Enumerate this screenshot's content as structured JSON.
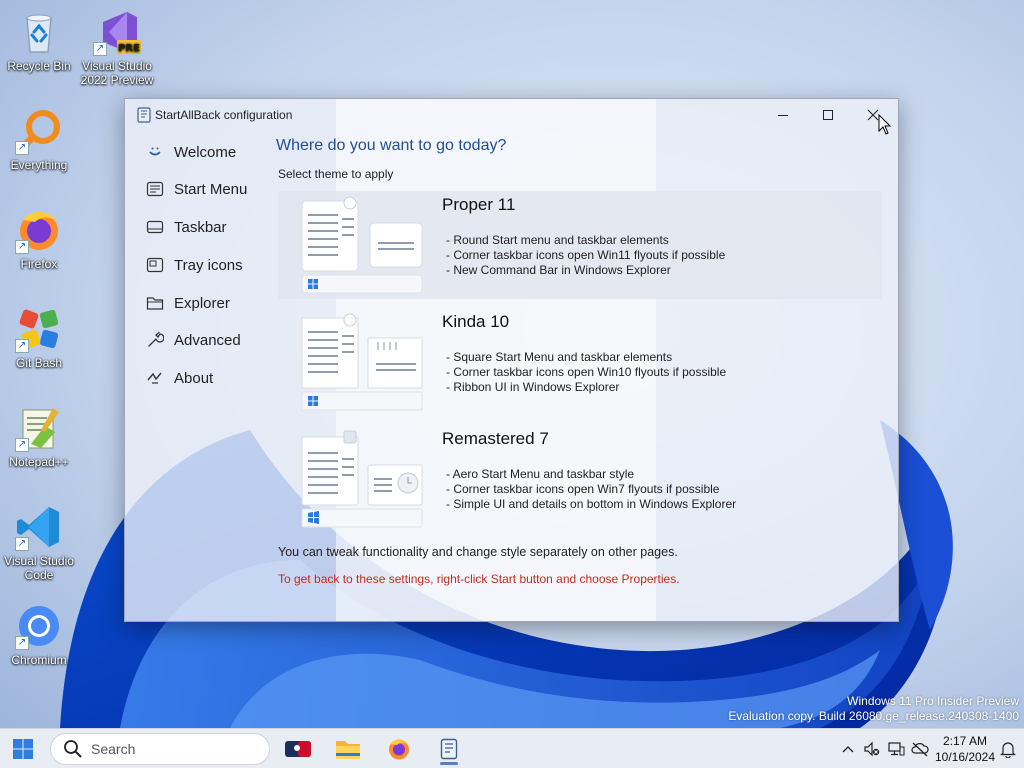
{
  "desktop": {
    "icons": [
      {
        "label": "Recycle Bin",
        "icon": "recycle-bin-icon"
      },
      {
        "label": "Visual Studio 2022 Preview",
        "icon": "visual-studio-icon",
        "badge": "PRE"
      },
      {
        "label": "Everything",
        "icon": "everything-search-icon"
      },
      {
        "label": "Firefox",
        "icon": "firefox-icon"
      },
      {
        "label": "Git Bash",
        "icon": "git-bash-icon"
      },
      {
        "label": "Notepad++",
        "icon": "notepad-plus-plus-icon"
      },
      {
        "label": "Visual Studio Code",
        "icon": "vscode-icon"
      },
      {
        "label": "Chromium",
        "icon": "chromium-icon"
      }
    ],
    "watermark": {
      "line1": "Windows 11 Pro Insider Preview",
      "line2": "Evaluation copy. Build 26080.ge_release.240308-1400"
    }
  },
  "window": {
    "title": "StartAllBack configuration",
    "nav": [
      {
        "label": "Welcome",
        "icon": "smile-icon"
      },
      {
        "label": "Start Menu",
        "icon": "start-menu-icon"
      },
      {
        "label": "Taskbar",
        "icon": "taskbar-icon"
      },
      {
        "label": "Tray icons",
        "icon": "tray-icon"
      },
      {
        "label": "Explorer",
        "icon": "folder-icon"
      },
      {
        "label": "Advanced",
        "icon": "wrench-icon"
      },
      {
        "label": "About",
        "icon": "about-icon"
      }
    ],
    "heading": "Where do you want to go today?",
    "subheading": "Select theme to apply",
    "themes": [
      {
        "name": "Proper 11",
        "features": [
          "- Round Start menu and taskbar elements",
          "- Corner taskbar icons open Win11 flyouts if possible",
          "- New Command Bar in Windows Explorer"
        ]
      },
      {
        "name": "Kinda 10",
        "features": [
          "- Square Start Menu and taskbar elements",
          "- Corner taskbar icons open Win10 flyouts if possible",
          "- Ribbon UI in Windows Explorer"
        ]
      },
      {
        "name": "Remastered 7",
        "features": [
          "- Aero Start Menu and taskbar style",
          "- Corner taskbar icons open Win7 flyouts if possible",
          "- Simple UI and details on bottom in Windows Explorer"
        ]
      }
    ],
    "note": "You can tweak functionality and change style separately on other pages.",
    "hint": "To get back to these settings, right-click Start button and choose Properties."
  },
  "taskbar": {
    "search_placeholder": "Search",
    "apps": [
      "mlb-app-icon",
      "file-explorer-icon",
      "firefox-icon",
      "startallback-icon"
    ],
    "clock": {
      "time": "2:17 AM",
      "date": "10/16/2024"
    }
  },
  "colors": {
    "accent": "#1f4f94",
    "hint": "#c42b1c",
    "taskbar": "#e8ecf3"
  }
}
